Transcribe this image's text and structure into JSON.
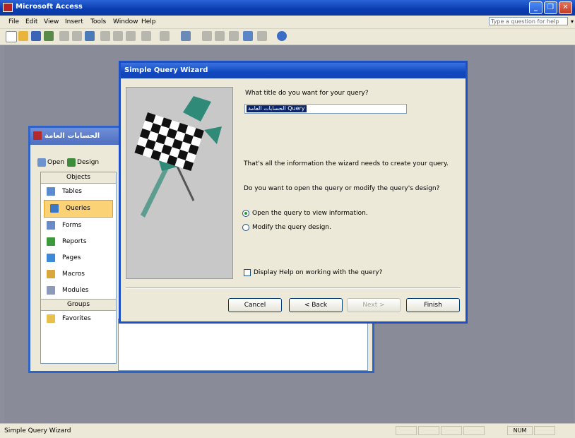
{
  "app": {
    "title": "Microsoft Access"
  },
  "menu": {
    "items": [
      "File",
      "Edit",
      "View",
      "Insert",
      "Tools",
      "Window",
      "Help"
    ],
    "ask_placeholder": "Type a question for help"
  },
  "db_window": {
    "title": "الحسابات العامة",
    "open_label": "Open",
    "design_label": "Design",
    "objects_header": "Objects",
    "objects": [
      "Tables",
      "Queries",
      "Forms",
      "Reports",
      "Pages",
      "Macros",
      "Modules"
    ],
    "selected_object": "Queries",
    "groups_header": "Groups",
    "groups": [
      "Favorites"
    ]
  },
  "wizard": {
    "title": "Simple Query Wizard",
    "title_question": "What title do you want for your query?",
    "title_value": "الحسابات العامة Query",
    "info_text": "That's all the information the wizard needs to create your query.",
    "open_or_modify_question": "Do you want to open the query or modify the query's design?",
    "radio_open": "Open the query to view information.",
    "radio_modify": "Modify the query design.",
    "selected_radio": "open",
    "checkbox_help": "Display Help on working with the query?",
    "cancel": "Cancel",
    "back": "< Back",
    "next": "Next >",
    "finish": "Finish"
  },
  "status": {
    "text": "Simple Query Wizard",
    "num": "NUM"
  }
}
